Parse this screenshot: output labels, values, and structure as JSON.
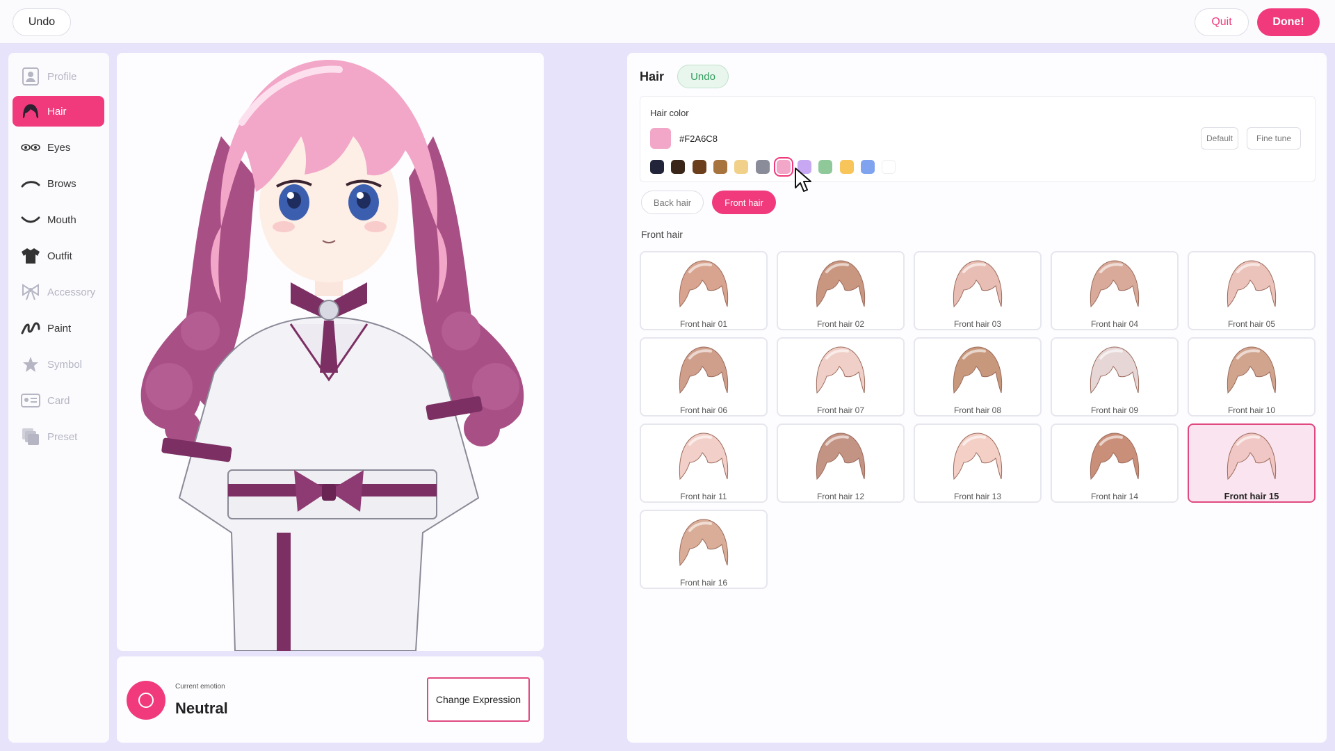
{
  "topbar": {
    "undo_label": "Undo",
    "quit_label": "Quit",
    "done_label": "Done!"
  },
  "sidebar": {
    "items": [
      {
        "label": "Profile",
        "icon": "profile-icon",
        "state": "disabled"
      },
      {
        "label": "Hair",
        "icon": "hair-icon",
        "state": "active"
      },
      {
        "label": "Eyes",
        "icon": "eyes-icon",
        "state": "normal"
      },
      {
        "label": "Brows",
        "icon": "brows-icon",
        "state": "normal"
      },
      {
        "label": "Mouth",
        "icon": "mouth-icon",
        "state": "normal"
      },
      {
        "label": "Outfit",
        "icon": "outfit-icon",
        "state": "normal"
      },
      {
        "label": "Accessory",
        "icon": "accessory-icon",
        "state": "disabled"
      },
      {
        "label": "Paint",
        "icon": "paint-icon",
        "state": "normal"
      },
      {
        "label": "Symbol",
        "icon": "symbol-icon",
        "state": "disabled"
      },
      {
        "label": "Card",
        "icon": "card-icon",
        "state": "disabled"
      },
      {
        "label": "Preset",
        "icon": "preset-icon",
        "state": "disabled"
      }
    ]
  },
  "emotion": {
    "label": "Current emotion",
    "value": "Neutral",
    "change_button": "Change Expression"
  },
  "hair_panel": {
    "title": "Hair",
    "undo_label": "Undo",
    "color_section": {
      "title": "Hair color",
      "current_hex": "#F2A6C8",
      "default_label": "Default",
      "fine_tune_label": "Fine tune",
      "swatches": [
        "#22243a",
        "#3a2618",
        "#6b3e1c",
        "#a8743e",
        "#f1d18a",
        "#8a8c9a",
        "#f2a6c8",
        "#c8a8f2",
        "#8fc99a",
        "#f7c55a",
        "#7fa3ef",
        "#ffffff"
      ],
      "selected_swatch": 6
    },
    "tabs": [
      {
        "label": "Back hair",
        "active": false
      },
      {
        "label": "Front hair",
        "active": true
      }
    ],
    "section_label": "Front hair",
    "items": [
      "Front hair 01",
      "Front hair 02",
      "Front hair 03",
      "Front hair 04",
      "Front hair 05",
      "Front hair 06",
      "Front hair 07",
      "Front hair 08",
      "Front hair 09",
      "Front hair 10",
      "Front hair 11",
      "Front hair 12",
      "Front hair 13",
      "Front hair 14",
      "Front hair 15",
      "Front hair 16"
    ],
    "selected_item": 14
  },
  "colors": {
    "accent": "#f03a7b",
    "hair_pink": "#f2a6c8",
    "hair_dark": "#a84f86",
    "outfit_purple": "#7b2f63"
  }
}
